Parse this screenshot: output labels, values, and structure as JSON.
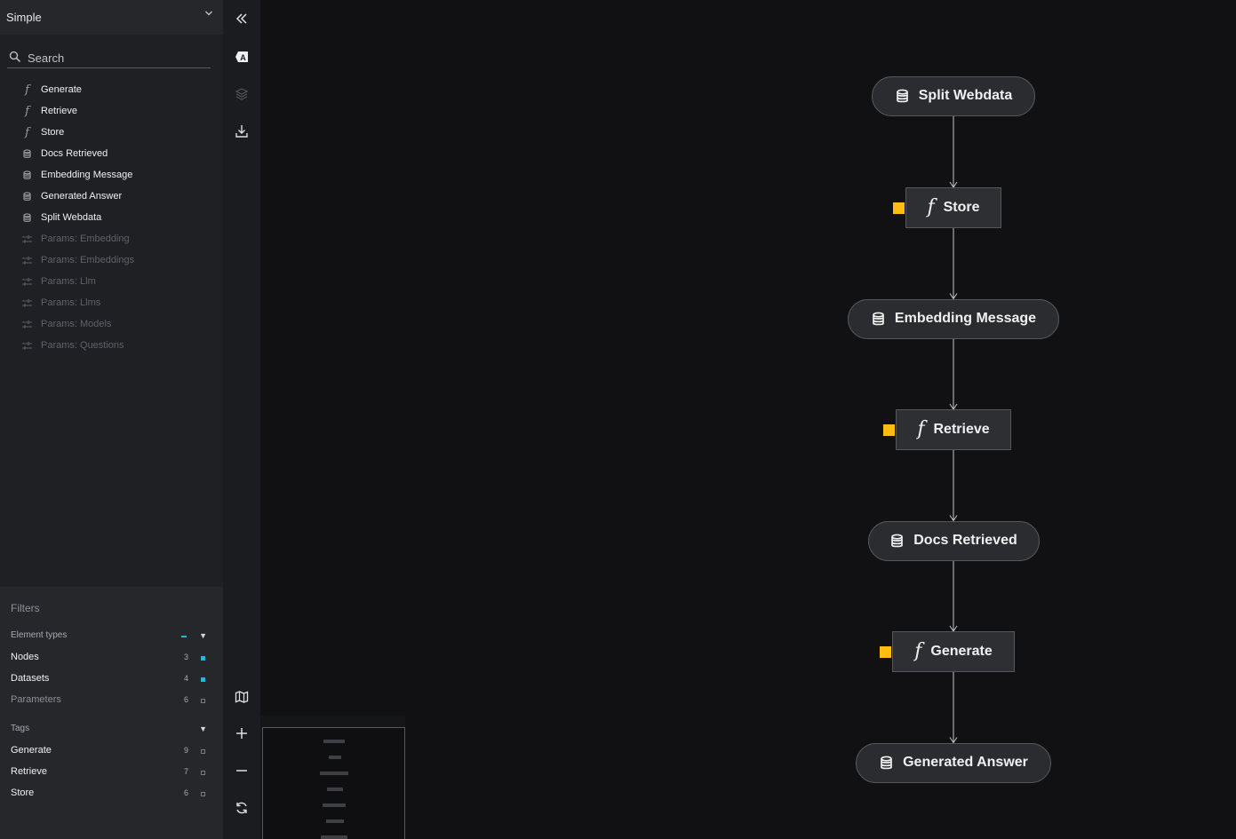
{
  "sidebar": {
    "pipeline": "Simple",
    "search_placeholder": "Search",
    "items": [
      {
        "label": "Generate",
        "kind": "function",
        "icon": "function-icon"
      },
      {
        "label": "Retrieve",
        "kind": "function",
        "icon": "function-icon"
      },
      {
        "label": "Store",
        "kind": "function",
        "icon": "function-icon"
      },
      {
        "label": "Docs Retrieved",
        "kind": "dataset",
        "icon": "database-icon"
      },
      {
        "label": "Embedding Message",
        "kind": "dataset",
        "icon": "database-icon"
      },
      {
        "label": "Generated Answer",
        "kind": "dataset",
        "icon": "database-icon"
      },
      {
        "label": "Split Webdata",
        "kind": "dataset",
        "icon": "database-icon"
      },
      {
        "label": "Params: Embedding",
        "kind": "parameter",
        "icon": "sliders-icon"
      },
      {
        "label": "Params: Embeddings",
        "kind": "parameter",
        "icon": "sliders-icon"
      },
      {
        "label": "Params: Llm",
        "kind": "parameter",
        "icon": "sliders-icon"
      },
      {
        "label": "Params: Llms",
        "kind": "parameter",
        "icon": "sliders-icon"
      },
      {
        "label": "Params: Models",
        "kind": "parameter",
        "icon": "sliders-icon"
      },
      {
        "label": "Params: Questions",
        "kind": "parameter",
        "icon": "sliders-icon"
      }
    ]
  },
  "filters": {
    "title": "Filters",
    "element_types": {
      "label": "Element types",
      "rows": [
        {
          "label": "Nodes",
          "count": "3",
          "checked": true
        },
        {
          "label": "Datasets",
          "count": "4",
          "checked": true
        },
        {
          "label": "Parameters",
          "count": "6",
          "checked": false
        }
      ]
    },
    "tags": {
      "label": "Tags",
      "rows": [
        {
          "label": "Generate",
          "count": "9",
          "checked": false
        },
        {
          "label": "Retrieve",
          "count": "7",
          "checked": false
        },
        {
          "label": "Store",
          "count": "6",
          "checked": false
        }
      ]
    }
  },
  "rail": {
    "buttons": [
      "collapse-sidebar-icon",
      "label-toggle-icon",
      "layers-icon",
      "export-icon",
      "minimap-toggle-icon",
      "zoom-in-icon",
      "zoom-out-icon",
      "reset-view-icon"
    ]
  },
  "graph": {
    "nodes": [
      {
        "label": "Split Webdata",
        "kind": "dataset"
      },
      {
        "label": "Store",
        "kind": "function",
        "tagged": true
      },
      {
        "label": "Embedding Message",
        "kind": "dataset"
      },
      {
        "label": "Retrieve",
        "kind": "function",
        "tagged": true
      },
      {
        "label": "Docs Retrieved",
        "kind": "dataset"
      },
      {
        "label": "Generate",
        "kind": "function",
        "tagged": true
      },
      {
        "label": "Generated Answer",
        "kind": "dataset"
      }
    ]
  },
  "colors": {
    "tag_marker": "#ffbc11",
    "filter_accent": "#1eb8e6",
    "canvas_bg": "#111113",
    "node_bg": "#2b2c30"
  }
}
